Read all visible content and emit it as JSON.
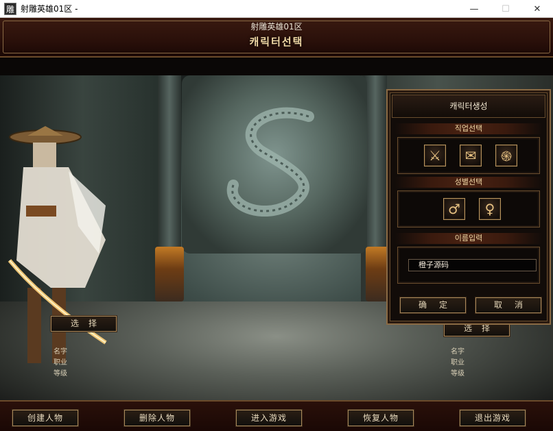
{
  "window": {
    "title": "射雕英雄01区 -",
    "app_icon_glyph": "雕",
    "minimize_glyph": "—",
    "maximize_glyph": "☐",
    "close_glyph": "✕"
  },
  "banner": {
    "server_name": "射雕英雄01区",
    "screen_title": "캐릭터선택"
  },
  "left_slot": {
    "select_label": "选择",
    "info_labels": [
      "名字",
      "职业",
      "等级"
    ]
  },
  "right_slot": {
    "select_label": "选择",
    "info_labels": [
      "名字",
      "职业",
      "等级"
    ]
  },
  "create_panel": {
    "title": "캐릭터생성",
    "job_section": "직업선택",
    "jobs": [
      {
        "icon": "sword-icon",
        "glyph": "⚔"
      },
      {
        "icon": "scroll-icon",
        "glyph": "✉"
      },
      {
        "icon": "swirl-icon",
        "glyph": "֍"
      }
    ],
    "gender_section": "성별선택",
    "genders": [
      {
        "icon": "male-icon",
        "glyph": "♂"
      },
      {
        "icon": "female-icon",
        "glyph": "♀"
      }
    ],
    "name_section": "이름입력",
    "name_value": "橙子源码",
    "confirm_label": "确定",
    "cancel_label": "取消"
  },
  "bottom_buttons": [
    "创建人物",
    "删除人物",
    "进入游戏",
    "恢复人物",
    "退出游戏"
  ],
  "colors": {
    "gold_text": "#f1d9a6",
    "button_border": "#a8875a",
    "frame_red": "#2a100a"
  }
}
